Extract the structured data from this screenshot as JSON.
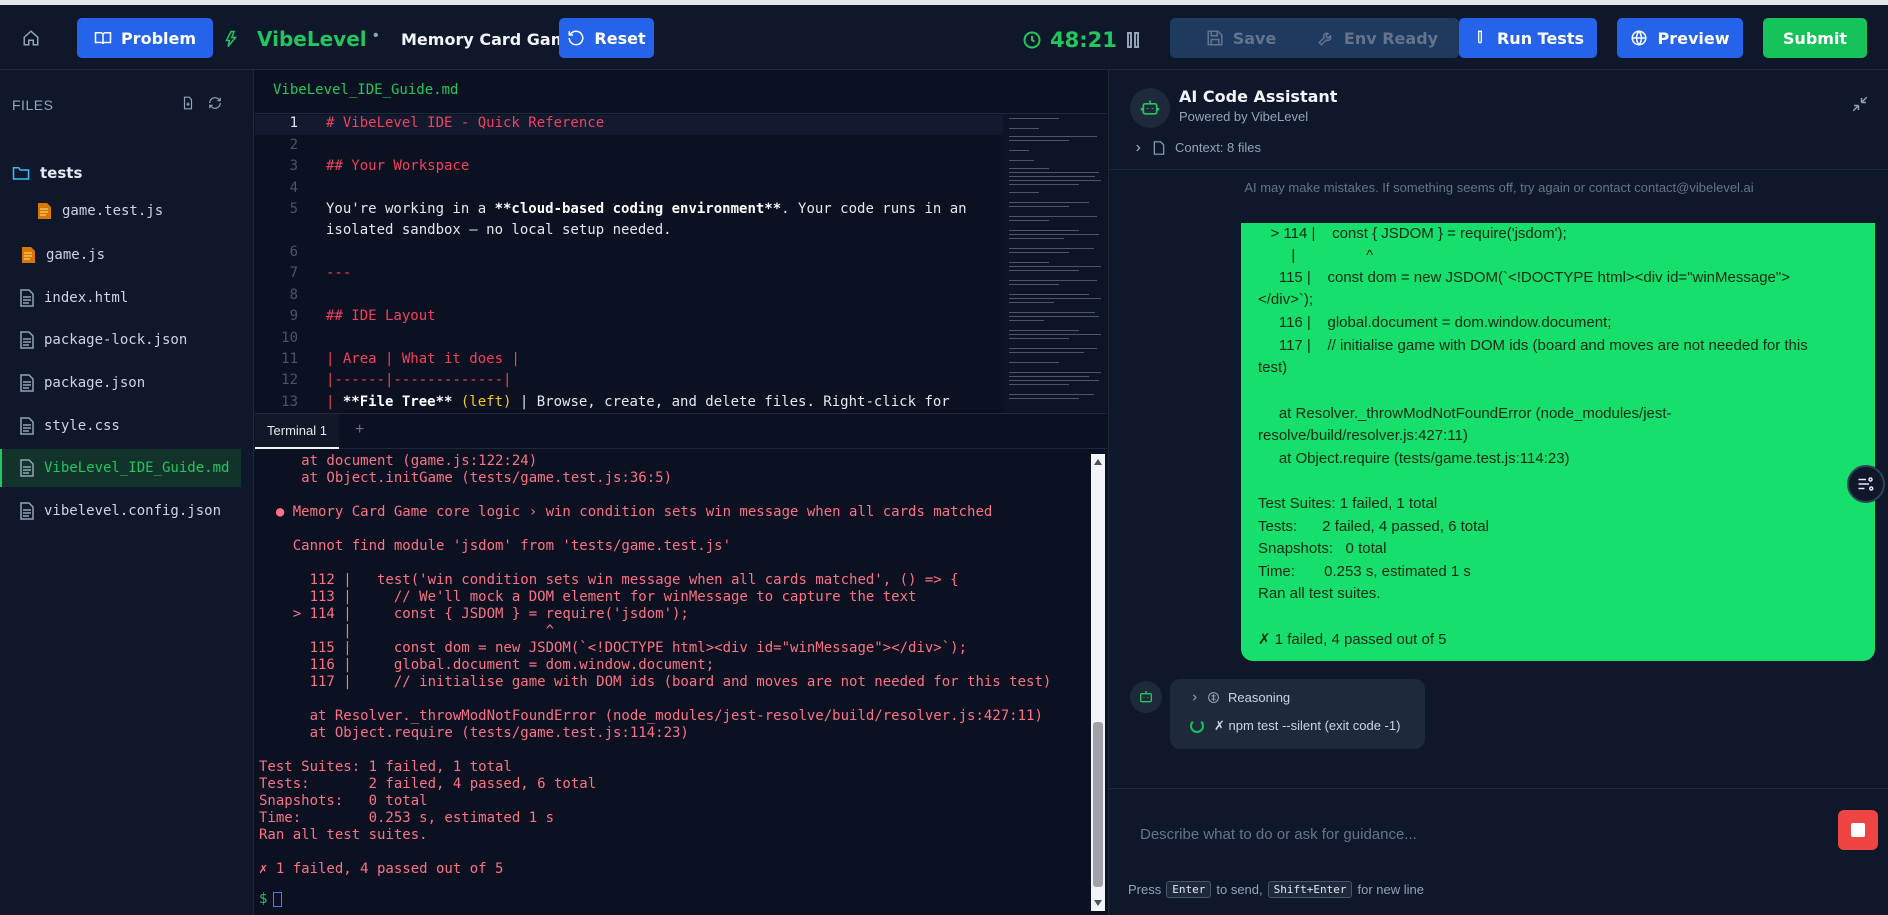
{
  "topbar": {
    "problem_label": "Problem",
    "brand": "VibeLevel",
    "separator": "•",
    "project": "Memory Card Game",
    "reset_label": "Reset",
    "timer": "48:21",
    "save_label": "Save",
    "env_label": "Env Ready",
    "run_label": "Run Tests",
    "preview_label": "Preview",
    "submit_label": "Submit"
  },
  "sidebar": {
    "header": "FILES",
    "items": [
      {
        "label": "tests",
        "kind": "folder"
      },
      {
        "label": "game.test.js",
        "kind": "js"
      },
      {
        "label": "game.js",
        "kind": "js"
      },
      {
        "label": "index.html",
        "kind": "file"
      },
      {
        "label": "package-lock.json",
        "kind": "file"
      },
      {
        "label": "package.json",
        "kind": "file"
      },
      {
        "label": "style.css",
        "kind": "file"
      },
      {
        "label": "VibeLevel_IDE_Guide.md",
        "kind": "file"
      },
      {
        "label": "vibelevel.config.json",
        "kind": "file"
      }
    ]
  },
  "editor": {
    "tab": "VibeLevel_IDE_Guide.md",
    "line_numbers": [
      "1",
      "2",
      "3",
      "4",
      "5",
      "6",
      "7",
      "8",
      "9",
      "10",
      "11",
      "12",
      "13"
    ],
    "lines": {
      "l1": "# VibeLevel IDE - Quick Reference",
      "l3": "## Your Workspace",
      "l5a": "You're working in a ",
      "l5b": "**cloud-based coding environment**",
      "l5c": ". Your code runs in an",
      "l5d": "isolated sandbox — no local setup needed.",
      "l7": "---",
      "l9": "## IDE Layout",
      "l11a": "| Area | What it does |",
      "l12": "|------|-------------|",
      "l13a": "| ",
      "l13b": "**File Tree**",
      "l13c": " (left) ",
      "l13d": "| Browse, create, and delete files. Right-click for"
    }
  },
  "terminal": {
    "tab": "Terminal 1",
    "plus": "+",
    "lines": [
      "     at document (game.js:122:24)",
      "     at Object.initGame (tests/game.test.js:36:5)",
      "",
      "  ● Memory Card Game core logic › win condition sets win message when all cards matched",
      "",
      "    Cannot find module 'jsdom' from 'tests/game.test.js'",
      "",
      "      112 |   test('win condition sets win message when all cards matched', () => {",
      "      113 |     // We'll mock a DOM element for winMessage to capture the text",
      "    > 114 |     const { JSDOM } = require('jsdom');",
      "          |                       ^",
      "      115 |     const dom = new JSDOM(`<!DOCTYPE html><div id=\"winMessage\"></div>`);",
      "      116 |     global.document = dom.window.document;",
      "      117 |     // initialise game with DOM ids (board and moves are not needed for this test)",
      "",
      "      at Resolver._throwModNotFoundError (node_modules/jest-resolve/build/resolver.js:427:11)",
      "      at Object.require (tests/game.test.js:114:23)",
      "",
      "Test Suites: 1 failed, 1 total",
      "Tests:       2 failed, 4 passed, 6 total",
      "Snapshots:   0 total",
      "Time:        0.253 s, estimated 1 s",
      "Ran all test suites.",
      "",
      "✗ 1 failed, 4 passed out of 5"
    ],
    "prompt": "$"
  },
  "assistant": {
    "title": "AI Code Assistant",
    "subtitle": "Powered by VibeLevel",
    "context": "Context: 8 files",
    "disclaimer": "AI may make mistakes. If something seems off, try again or contact contact@vibelevel.ai",
    "message_lines": [
      "   > 114 |    const { JSDOM } = require('jsdom');",
      "        |                 ^",
      "     115 |    const dom = new JSDOM(`<!DOCTYPE html><div id=\"winMessage\">",
      "</div>`);",
      "     116 |    global.document = dom.window.document;",
      "     117 |    // initialise game with DOM ids (board and moves are not needed for this",
      "test)",
      "",
      "     at Resolver._throwModNotFoundError (node_modules/jest-",
      "resolve/build/resolver.js:427:11)",
      "     at Object.require (tests/game.test.js:114:23)",
      "",
      "Test Suites: 1 failed, 1 total",
      "Tests:      2 failed, 4 passed, 6 total",
      "Snapshots:   0 total",
      "Time:       0.253 s, estimated 1 s",
      "Ran all test suites.",
      "",
      "✗ 1 failed, 4 passed out of 5"
    ],
    "reasoning_label": "Reasoning",
    "reasoning_cmd": "✗ npm test --silent (exit code -1)",
    "input_placeholder": "Describe what to do or ask for guidance...",
    "hint_press": "Press",
    "hint_enter": "Enter",
    "hint_send": "to send,",
    "hint_shift": "Shift+Enter",
    "hint_newline": "for new line"
  },
  "colors": {
    "accent_blue": "#2563eb",
    "accent_green": "#22c55e",
    "error_red": "#fb7185",
    "message_bg": "#16e06b"
  }
}
